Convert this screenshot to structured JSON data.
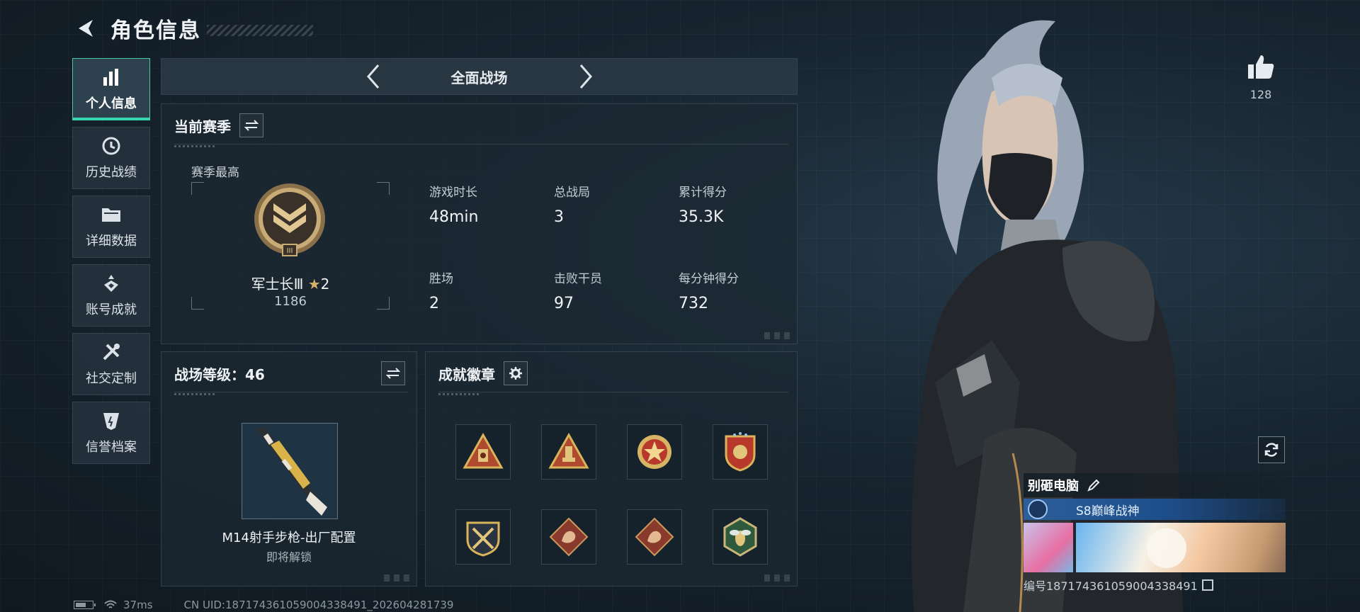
{
  "header": {
    "title": "角色信息"
  },
  "nav": {
    "items": [
      {
        "label": "个人信息",
        "icon": "bar-chart-icon",
        "active": true
      },
      {
        "label": "历史战绩",
        "icon": "history-clock-icon",
        "active": false
      },
      {
        "label": "详细数据",
        "icon": "folder-icon",
        "active": false
      },
      {
        "label": "账号成就",
        "icon": "achievement-icon",
        "active": false
      },
      {
        "label": "社交定制",
        "icon": "tools-icon",
        "active": false
      },
      {
        "label": "信誉档案",
        "icon": "shield-emblem-icon",
        "active": false
      }
    ]
  },
  "mode": {
    "label": "全面战场"
  },
  "season": {
    "title": "当前赛季",
    "best_label": "赛季最高",
    "rank_name": "军士长Ⅲ",
    "rank_stars": "2",
    "rank_score": "1186",
    "stats": [
      {
        "label": "游戏时长",
        "value": "48min"
      },
      {
        "label": "总战局",
        "value": "3"
      },
      {
        "label": "累计得分",
        "value": "35.3K"
      },
      {
        "label": "胜场",
        "value": "2"
      },
      {
        "label": "击败干员",
        "value": "97"
      },
      {
        "label": "每分钟得分",
        "value": "732"
      }
    ]
  },
  "level": {
    "title": "战场等级：46",
    "weapon_name": "M14射手步枪-出厂配置",
    "weapon_sub": "即将解锁"
  },
  "badges": {
    "title": "成就徽章",
    "items": [
      "triangle-medal-icon",
      "triangle-medal-icon",
      "star-medal-icon",
      "shield-medal-icon",
      "crossed-shield-icon",
      "dragon-badge-icon",
      "dragon-badge-icon",
      "bee-hexagon-icon"
    ]
  },
  "footer": {
    "ping": "37ms",
    "uid": "CN UID:1871743610590043384​91_202604281739"
  },
  "likes": {
    "count": "128"
  },
  "player": {
    "name": "别砸电脑",
    "title": "S8巅峰战神",
    "id": "编号1871743610590043384​91"
  },
  "colors": {
    "accent": "#36d6b1",
    "gold": "#d5b26a"
  }
}
